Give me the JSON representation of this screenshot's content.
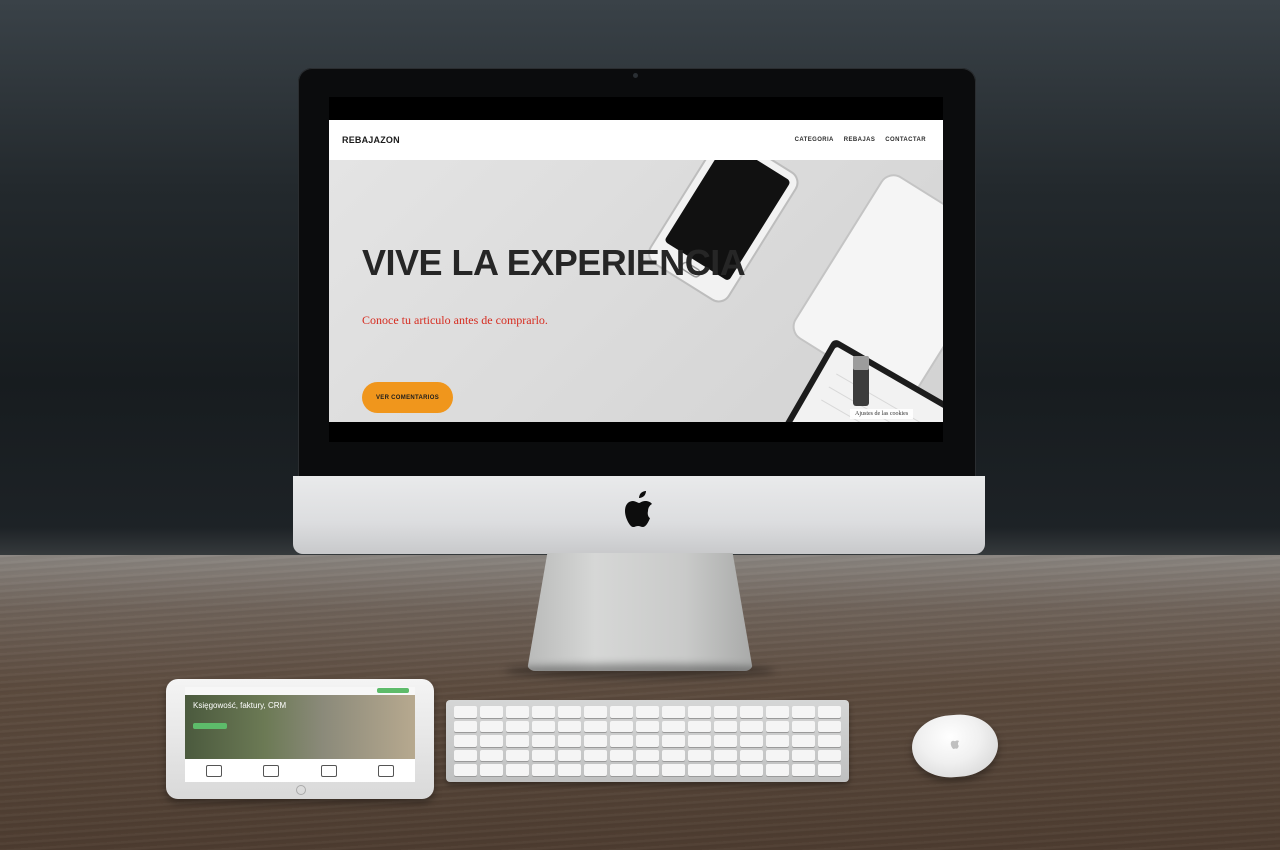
{
  "site": {
    "brand": "REBAJAZON",
    "nav": [
      "CATEGORIA",
      "REBAJAS",
      "CONTACTAR"
    ],
    "hero_title": "VIVE LA EXPERIENCIA",
    "hero_subtitle": "Conoce tu articulo antes de comprarlo.",
    "cta_label": "VER COMENTARIOS",
    "cookie_settings": "Ajustes de las cookies"
  },
  "tablet": {
    "hero_text": "Księgowość, faktury, CRM"
  },
  "colors": {
    "cta": "#f0961c",
    "subtitle": "#d62b1f",
    "header_bg": "#ffffff"
  },
  "icons": {
    "apple_logo": "apple-logo-icon",
    "camera": "camera-icon"
  }
}
